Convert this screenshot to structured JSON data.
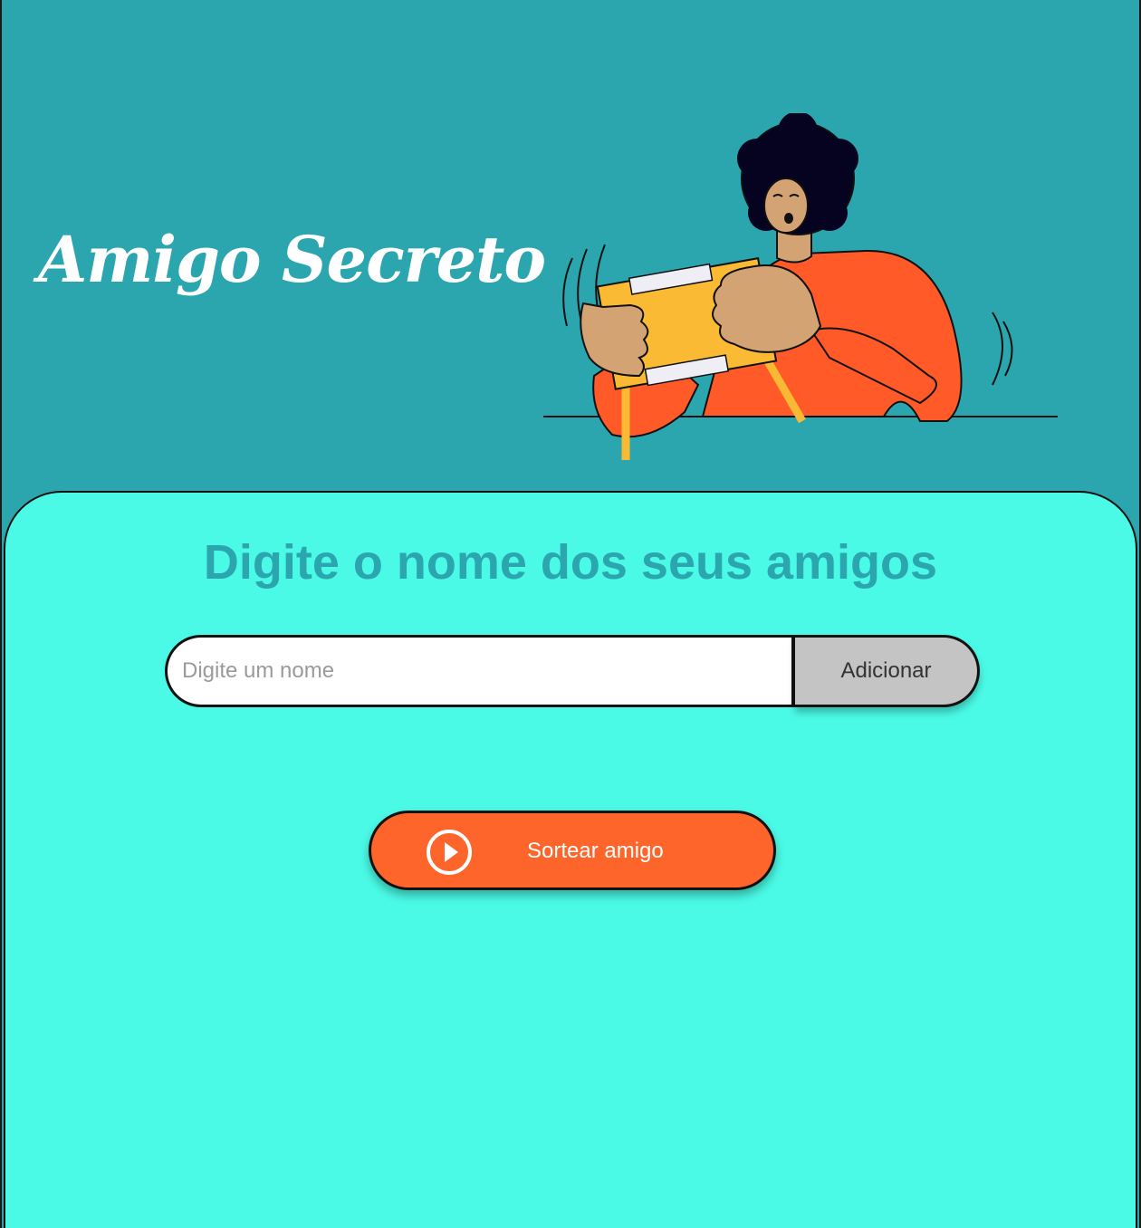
{
  "header": {
    "title": "Amigo Secreto"
  },
  "main": {
    "heading": "Digite o nome dos seus amigos",
    "name_input": {
      "placeholder": "Digite um nome",
      "value": ""
    },
    "add_button_label": "Adicionar",
    "draw_button_label": "Sortear amigo"
  },
  "icons": {
    "draw_button_icon": "play-circle-icon",
    "header_illustration": "person-shaking-gift-box"
  },
  "colors": {
    "header_background": "#2ca6ae",
    "card_background": "#4afae6",
    "heading_text": "#2ca6ae",
    "add_button_background": "#c4c4c4",
    "draw_button_background": "#fe652b"
  }
}
